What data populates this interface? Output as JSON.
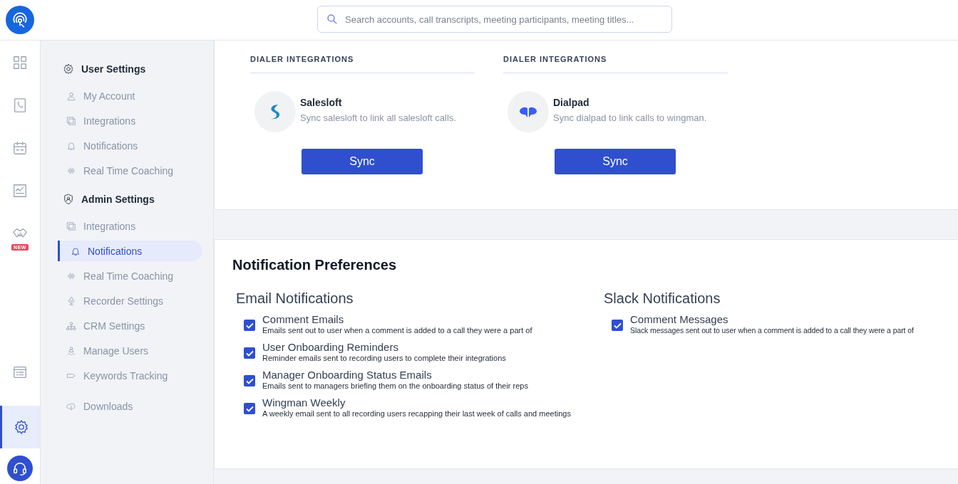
{
  "search": {
    "placeholder": "Search accounts, call transcripts, meeting participants, meeting titles..."
  },
  "rail": [
    {
      "selected": false
    },
    {
      "selected": false
    },
    {
      "selected": false
    },
    {
      "selected": false
    },
    {
      "selected": false,
      "badge": "NEW"
    },
    {
      "selected": false
    },
    {
      "selected": true
    }
  ],
  "sidebar": {
    "sections": [
      {
        "heading": "User Settings",
        "items": [
          {
            "label": "My Account",
            "selected": false
          },
          {
            "label": "Integrations",
            "selected": false
          },
          {
            "label": "Notifications",
            "selected": false
          },
          {
            "label": "Real Time Coaching",
            "selected": false
          }
        ]
      },
      {
        "heading": "Admin Settings",
        "items": [
          {
            "label": "Integrations",
            "selected": false
          },
          {
            "label": "Notifications",
            "selected": true
          },
          {
            "label": "Real Time Coaching",
            "selected": false
          },
          {
            "label": "Recorder Settings",
            "selected": false
          },
          {
            "label": "CRM Settings",
            "selected": false
          },
          {
            "label": "Manage Users",
            "selected": false
          },
          {
            "label": "Keywords Tracking",
            "selected": false
          }
        ]
      },
      {
        "items": [
          {
            "label": "Downloads",
            "selected": false
          }
        ]
      }
    ]
  },
  "integrations": [
    {
      "heading": "DIALER INTEGRATIONS",
      "name": "Salesloft",
      "description": "Sync salesloft to link all salesloft calls.",
      "button": "Sync"
    },
    {
      "heading": "DIALER INTEGRATIONS",
      "name": "Dialpad",
      "description": "Sync dialpad to link calls to wingman.",
      "button": "Sync"
    }
  ],
  "preferences": {
    "title": "Notification Preferences",
    "columns": [
      {
        "title": "Email Notifications",
        "items": [
          {
            "title": "Comment Emails",
            "description": "Emails sent out to user when a comment is added to a call they were a part of",
            "checked": true
          },
          {
            "title": "User Onboarding Reminders",
            "description": "Reminder emails sent to recording users to complete their integrations",
            "checked": true
          },
          {
            "title": "Manager Onboarding Status Emails",
            "description": "Emails sent to managers briefing them on the onboarding status of their reps",
            "checked": true
          },
          {
            "title": "Wingman Weekly",
            "description": "A weekly email sent to all recording users recapping their last week of calls and meetings",
            "checked": true
          }
        ]
      },
      {
        "title": "Slack Notifications",
        "items": [
          {
            "title": "Comment Messages",
            "description": "Slack messages sent out to user when a comment is added to a call they were a part of",
            "checked": true
          }
        ]
      }
    ]
  }
}
